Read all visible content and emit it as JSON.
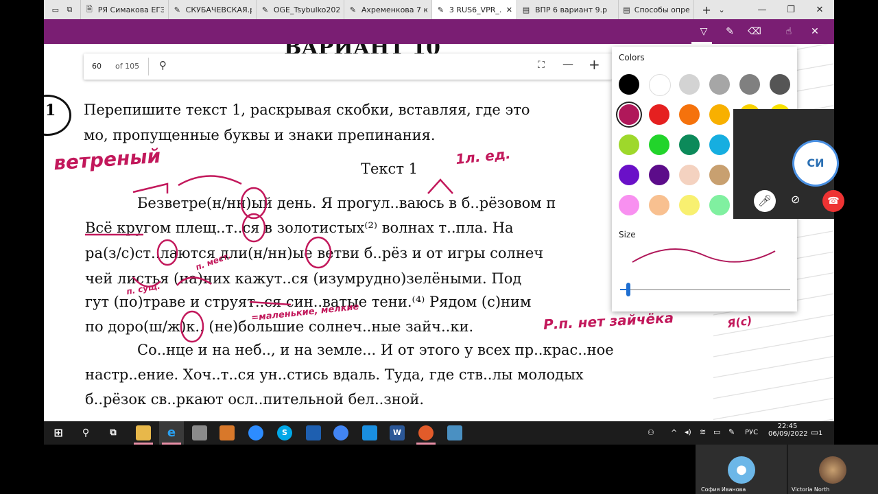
{
  "browser": {
    "tabs": [
      {
        "label": "РЯ Симакова ЕГЭ :",
        "icon": "document-icon"
      },
      {
        "label": "СКУБАЧЕВСКАЯ.рс",
        "icon": "edit-icon"
      },
      {
        "label": "OGE_Tsybulko2020",
        "icon": "edit-icon"
      },
      {
        "label": "Ахременкова 7 кл",
        "icon": "edit-icon"
      },
      {
        "label": "3 RUS6_VPR_.p",
        "icon": "edit-icon",
        "active": true
      },
      {
        "label": "ВПР 6 вариант 9.р",
        "icon": "pdf-icon"
      },
      {
        "label": "Способы опред сг",
        "icon": "pdf-icon"
      }
    ]
  },
  "pagebar": {
    "page": "60",
    "total": "of 105"
  },
  "doc": {
    "heading": "ВАРИАНТ 10",
    "task_number": "1",
    "task_line1": "Перепишите текст 1, раскрывая скобки, вставляя, где это",
    "task_line2": "мо, пропущенные буквы и знаки препинания.",
    "text_title": "Текст 1",
    "lines": [
      "Безветре(н/нн)ый день. Я прогул..ваюсь в б..рёзовом п",
      "Всё кругом плещ..т..ся в золотистых⁽²⁾ волнах т..пла. На",
      "ра(з/с)ст..лаются дли(н/нн)ые ветви б..рёз и от игры солнеч",
      "чей листья (на)них кажут..ся (изумрудно)зелёными. Под",
      "гут (по)траве и струят..ся син..ватые тени.⁽⁴⁾ Рядом (с)ним",
      "по доро(ш/ж)к.. (не)большие солнеч..ные зайч..ки.",
      "Со..нце и на неб.., и на земле... И от этого у всех пр..крас..ное",
      "настр..ение. Хоч..т..ся ун..стись вдаль. Туда, где ств..лы молодых",
      "б..рёзок св..ркают осл..пительной бел..зной."
    ],
    "annotations": {
      "a1": "ветреный",
      "a2": "1л. ед.",
      "a3": "Р.п. нет зайчёка",
      "a4": "=маленькие, мелкие",
      "a5": "п. мест.",
      "a6": "п. сущ."
    }
  },
  "colors_panel": {
    "title": "Colors",
    "size_label": "Size",
    "swatches": [
      "#000000",
      "#ffffff",
      "#d3d3d3",
      "#a6a6a6",
      "#808080",
      "#555555",
      "#b0185a",
      "#e52020",
      "#f5720c",
      "#f8b000",
      "#f8d000",
      "#f8e000",
      "#9ed82b",
      "#22d42b",
      "#0c8a5a",
      "#16aee0",
      "#2060d8",
      "#3040c0",
      "#6a10c8",
      "#5c0c8a",
      "#f4d2c0",
      "#c8a070",
      "#805030",
      "#503020",
      "#f890f0",
      "#f8c090",
      "#f8f070",
      "#80f0a0",
      "#70e0e8",
      "#a0c0f0"
    ],
    "selected_index": 6,
    "size_value": 0.05
  },
  "meeting": {
    "avatar_initials": "СИ"
  },
  "taskbar": {
    "time": "22:45",
    "date": "06/09/2022",
    "lang": "РУС",
    "notif": "1"
  },
  "participants": {
    "p1": "София Иванова",
    "p2": "Victoria North"
  }
}
